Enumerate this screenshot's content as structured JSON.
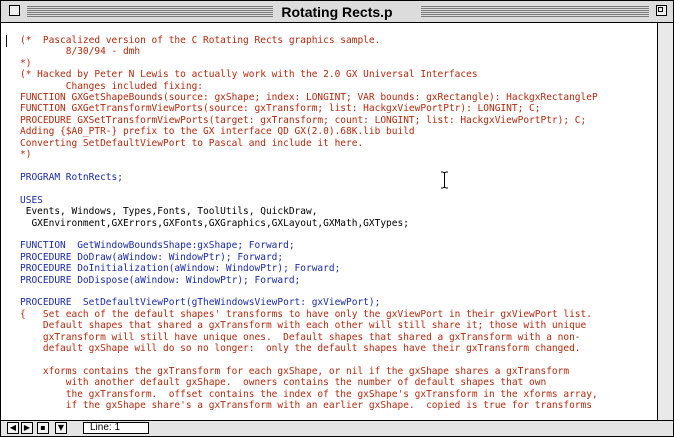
{
  "window": {
    "title": "Rotating Rects.p"
  },
  "code_lines": [
    {
      "t": "cm",
      "s": "(*  Pascalized version of the C Rotating Rects graphics sample."
    },
    {
      "t": "cm",
      "s": "        8/30/94 - dmh"
    },
    {
      "t": "cm",
      "s": "*)"
    },
    {
      "t": "cm",
      "s": "(* Hacked by Peter N Lewis to actually work with the 2.0 GX Universal Interfaces"
    },
    {
      "t": "cm",
      "s": "        Changes included fixing:"
    },
    {
      "t": "cm",
      "s": "FUNCTION GXGetShapeBounds(source: gxShape; index: LONGINT; VAR bounds: gxRectangle): HackgxRectangleP"
    },
    {
      "t": "cm",
      "s": "FUNCTION GXGetTransformViewPorts(source: gxTransform; list: HackgxViewPortPtr): LONGINT; C;"
    },
    {
      "t": "cm",
      "s": "PROCEDURE GXSetTransformViewPorts(target: gxTransform; count: LONGINT; list: HackgxViewPortPtr); C;"
    },
    {
      "t": "cm",
      "s": "Adding {$A0_PTR-} prefix to the GX interface QD GX(2.0).68K.lib build"
    },
    {
      "t": "cm",
      "s": "Converting SetDefaultViewPort to Pascal and include it here."
    },
    {
      "t": "cm",
      "s": "*)"
    },
    {
      "t": "tx",
      "s": ""
    },
    {
      "t": "kw",
      "s": "PROGRAM RotnRects;"
    },
    {
      "t": "tx",
      "s": ""
    },
    {
      "t": "kw",
      "s": "USES"
    },
    {
      "t": "tx",
      "s": " Events, Windows, Types,Fonts, ToolUtils, QuickDraw,"
    },
    {
      "t": "tx",
      "s": "  GXEnvironment,GXErrors,GXFonts,GXGraphics,GXLayout,GXMath,GXTypes;"
    },
    {
      "t": "tx",
      "s": ""
    },
    {
      "t": "kw",
      "s": "FUNCTION  GetWindowBoundsShape:gxShape; Forward;"
    },
    {
      "t": "kw",
      "s": "PROCEDURE DoDraw(aWindow: WindowPtr); Forward;"
    },
    {
      "t": "kw",
      "s": "PROCEDURE DoInitialization(aWindow: WindowPtr); Forward;"
    },
    {
      "t": "kw",
      "s": "PROCEDURE DoDispose(aWindow: WindowPtr); Forward;"
    },
    {
      "t": "tx",
      "s": ""
    },
    {
      "t": "kw",
      "s": "PROCEDURE  SetDefaultViewPort(gTheWindowsViewPort: gxViewPort);"
    },
    {
      "t": "cm",
      "s": "{   Set each of the default shapes' transforms to have only the gxViewPort in their gxViewPort list."
    },
    {
      "t": "cm",
      "s": "    Default shapes that shared a gxTransform with each other will still share it; those with unique"
    },
    {
      "t": "cm",
      "s": "    gxTransform will still have unique ones.  Default shapes that shared a gxTransform with a non-"
    },
    {
      "t": "cm",
      "s": "    default gxShape will do so no longer:  only the default shapes have their gxTransform changed."
    },
    {
      "t": "tx",
      "s": ""
    },
    {
      "t": "cm",
      "s": "    xforms contains the gxTransform for each gxShape, or nil if the gxShape shares a gxTransform"
    },
    {
      "t": "cm",
      "s": "        with another default gxShape.  owners contains the number of default shapes that own"
    },
    {
      "t": "cm",
      "s": "        the gxTransform.  offset contains the index of the gxShape's gxTransform in the xforms array,"
    },
    {
      "t": "cm",
      "s": "        if the gxShape share's a gxTransform with an earlier gxShape.  copied is true for transforms"
    }
  ],
  "statusbar": {
    "line_label": "Line: 1"
  },
  "colors": {
    "comment": "#b3290d",
    "keyword": "#1a2aa8",
    "text": "#000000"
  },
  "icons": [
    "close-box-icon",
    "zoom-box-icon",
    "ibeam-cursor-icon"
  ]
}
